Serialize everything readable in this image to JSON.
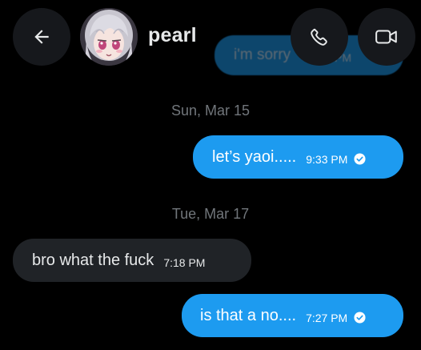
{
  "header": {
    "contact_name": "pearl",
    "back_icon": "arrow-left-icon",
    "call_icon": "phone-icon",
    "video_icon": "video-camera-icon"
  },
  "ghost_message": {
    "text": "i'm sorry",
    "time": "PM"
  },
  "conversation": {
    "dates": [
      "Sun, Mar 15",
      "Tue, Mar 17"
    ],
    "messages": [
      {
        "direction": "outgoing",
        "text": "let’s yaoi.....",
        "time": "9:33 PM",
        "status": "read"
      },
      {
        "direction": "incoming",
        "text": "bro what the fuck",
        "time": "7:18 PM"
      },
      {
        "direction": "outgoing",
        "text": "is that a no....",
        "time": "7:27 PM",
        "status": "read"
      }
    ]
  },
  "colors": {
    "background": "#000000",
    "outgoing_bubble": "#1d9bf0",
    "incoming_bubble": "#202327",
    "header_button": "#16181c",
    "muted_text": "#71767b"
  }
}
